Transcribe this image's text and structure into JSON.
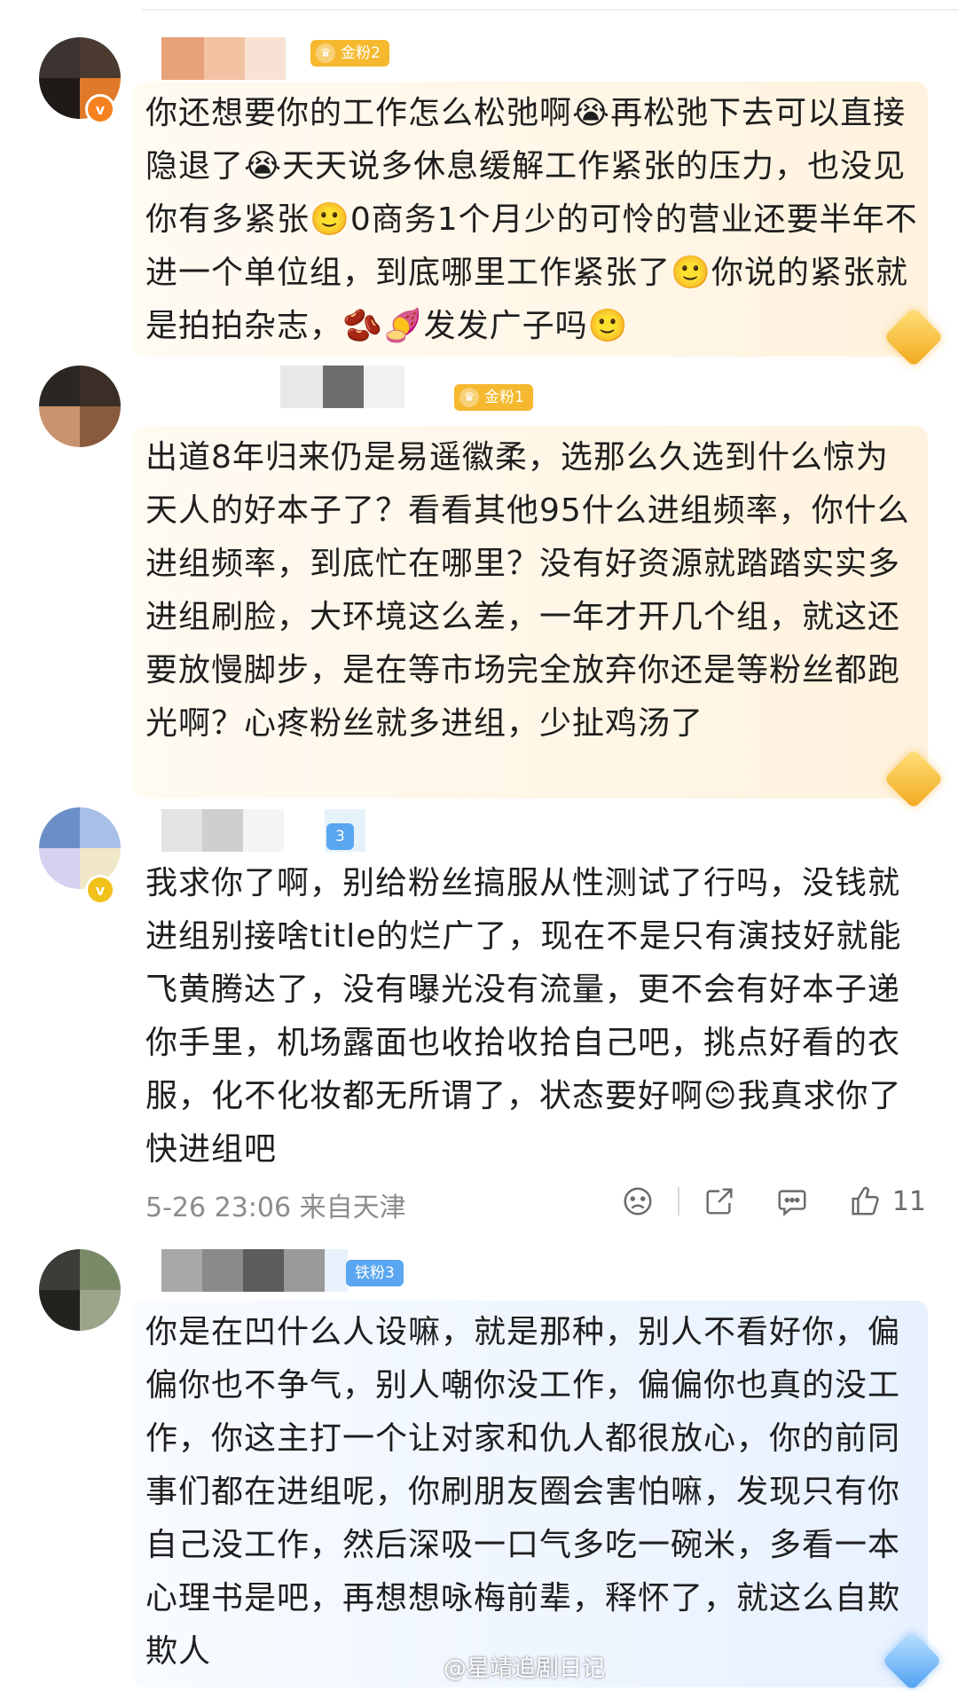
{
  "comments": [
    {
      "badge": "金粉2",
      "text": "你还想要你的工作怎么松弛啊😭再松弛下去可以直接隐退了😭天天说多休息缓解工作紧张的压力，也没见你有多紧张🙂0商务1个月少的可怜的营业还要半年不进一个单位组，到底哪里工作紧张了🙂你说的紧张就是拍拍杂志，🫘🍠发发广子吗🙂"
    },
    {
      "badge": "金粉1",
      "text": "出道8年归来仍是易遥徽柔，选那么久选到什么惊为天人的好本子了？看看其他95什么进组频率，你什么进组频率，到底忙在哪里？没有好资源就踏踏实实多进组刷脸，大环境这么差，一年才开几个组，就这还要放慢脚步，是在等市场完全放弃你还是等粉丝都跑光啊？心疼粉丝就多进组，少扯鸡汤了"
    },
    {
      "badge": "3",
      "text": "我求你了啊，别给粉丝搞服从性测试了行吗，没钱就进组别接啥title的烂广了，现在不是只有演技好就能飞黄腾达了，没有曝光没有流量，更不会有好本子递你手里，机场露面也收拾收拾自己吧，挑点好看的衣服，化不化妆都无所谓了，状态要好啊😊我真求你了快进组吧",
      "time": "5-26 23:06 来自天津",
      "likes": "11"
    },
    {
      "badge": "铁粉3",
      "text": "你是在凹什么人设嘛，就是那种，别人不看好你，偏偏你也不争气，别人嘲你没工作，偏偏你也真的没工作，你这主打一个让对家和仇人都很放心，你的前同事们都在进组呢，你刷朋友圈会害怕嘛，发现只有你自己没工作，然后深吸一口气多吃一碗米，多看一本心理书是吧，再想想咏梅前辈，释怀了，就这么自欺欺人"
    }
  ],
  "watermark": "@星靖追剧日记",
  "icons": [
    "dislike-icon",
    "share-icon",
    "comment-icon",
    "like-icon"
  ],
  "colors": {
    "gold_badge": "#f5b82e",
    "blue_badge": "#5aa6f0",
    "verified_orange": "#f5821f",
    "verified_gold": "#f2c21a"
  }
}
